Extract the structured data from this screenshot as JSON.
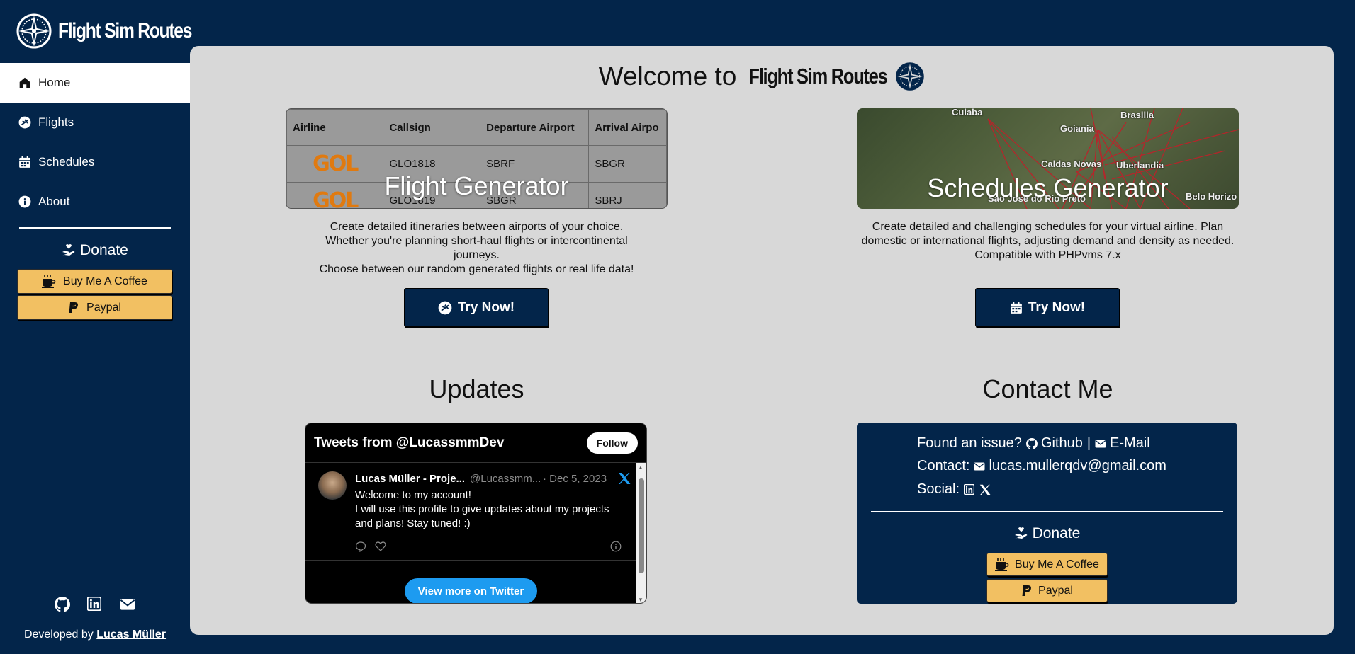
{
  "brand": {
    "name": "Flight Sim Routes",
    "logo_icon": "compass-rose-icon"
  },
  "sidebar": {
    "nav": [
      {
        "label": "Home",
        "icon": "home-icon",
        "active": true
      },
      {
        "label": "Flights",
        "icon": "plane-circle-icon",
        "active": false
      },
      {
        "label": "Schedules",
        "icon": "calendar-icon",
        "active": false
      },
      {
        "label": "About",
        "icon": "info-icon",
        "active": false
      }
    ],
    "donate_title": "Donate",
    "coffee_label": "Buy Me A Coffee",
    "paypal_label": "Paypal",
    "dev_prefix": "Developed by",
    "dev_name": "Lucas Müller"
  },
  "main": {
    "welcome_prefix": "Welcome to",
    "welcome_brand": "Flight Sim Routes",
    "flight_card": {
      "title": "Flight Generator",
      "table_headers": [
        "Airline",
        "Callsign",
        "Departure Airport",
        "Arrival Airpo"
      ],
      "rows": [
        {
          "airline": "GOL",
          "callsign": "GLO1818",
          "dep": "SBRF",
          "arr": "SBGR"
        },
        {
          "airline": "GOL",
          "callsign": "GLO1819",
          "dep": "SBGR",
          "arr": "SBRJ"
        }
      ],
      "desc": [
        "Create detailed itineraries between airports of your choice.",
        "Whether you're planning short-haul flights or intercontinental journeys.",
        "Choose between our random generated flights or real life data!"
      ],
      "button": "Try Now!"
    },
    "schedule_card": {
      "title": "Schedules Generator",
      "map_labels": [
        "Cuiaba",
        "Brasilia",
        "Goiania",
        "Caldas Novas",
        "Uberlandia",
        "Sao José do Rio Preto",
        "Belo Horizo"
      ],
      "desc": [
        "Create detailed and challenging schedules for your virtual airline. Plan domestic or international flights, adjusting demand and density as needed.",
        "Compatible with PHPvms 7.x"
      ],
      "button": "Try Now!"
    },
    "updates": {
      "title": "Updates",
      "widget_title": "Tweets from @LucassmmDev",
      "follow": "Follow",
      "tweet": {
        "name": "Lucas Müller - Proje...",
        "handle": "@Lucassmm...",
        "date": "· Dec 5, 2023",
        "line1": "Welcome to my account!",
        "line2": "I will use this profile to give updates about my projects and plans! Stay tuned! :)"
      },
      "view_more": "View more on Twitter"
    },
    "contact": {
      "title": "Contact Me",
      "issue_label": "Found an issue?",
      "github": "Github",
      "divider": "|",
      "email_link": "E-Mail",
      "contact_label": "Contact:",
      "email": "lucas.mullerqdv@gmail.com",
      "social_label": "Social:",
      "donate_title": "Donate",
      "coffee_label": "Buy Me A Coffee",
      "paypal_label": "Paypal"
    }
  },
  "colors": {
    "navy": "#03254a",
    "panel": "#d8d8d8",
    "coffee_yellow": "#f2c062",
    "twitter_blue": "#1d9bf0",
    "route_red": "#c0202a"
  }
}
